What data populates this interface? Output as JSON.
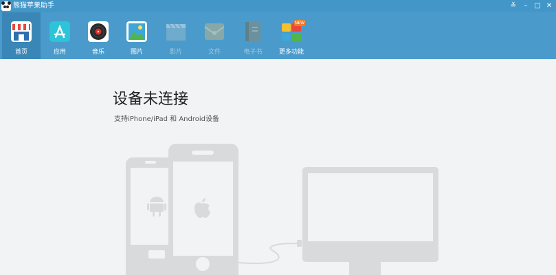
{
  "window": {
    "title": "熊猫苹果助手",
    "controls": {
      "menu": "≚",
      "minimize": "–",
      "maximize": "□",
      "close": "✕"
    }
  },
  "toolbar": {
    "items": [
      {
        "label": "首页",
        "icon": "store-icon",
        "state": "active"
      },
      {
        "label": "应用",
        "icon": "app-store-icon",
        "state": "enabled"
      },
      {
        "label": "音乐",
        "icon": "music-disc-icon",
        "state": "enabled"
      },
      {
        "label": "图片",
        "icon": "picture-icon",
        "state": "enabled"
      },
      {
        "label": "影片",
        "icon": "clapperboard-icon",
        "state": "disabled"
      },
      {
        "label": "文件",
        "icon": "file-icon",
        "state": "disabled"
      },
      {
        "label": "电子书",
        "icon": "ebook-icon",
        "state": "disabled"
      },
      {
        "label": "更多功能",
        "icon": "more-features-icon",
        "state": "enabled",
        "badge": "NEW"
      }
    ]
  },
  "main": {
    "title": "设备未连接",
    "subtitle": "支持iPhone/iPad 和 Android设备"
  },
  "colors": {
    "titlebar": "#4397c8",
    "toolbar": "#4a9bcb",
    "active_tab": "#3a86b6",
    "background": "#f1f3f5",
    "illustration": "#d9dadb"
  }
}
